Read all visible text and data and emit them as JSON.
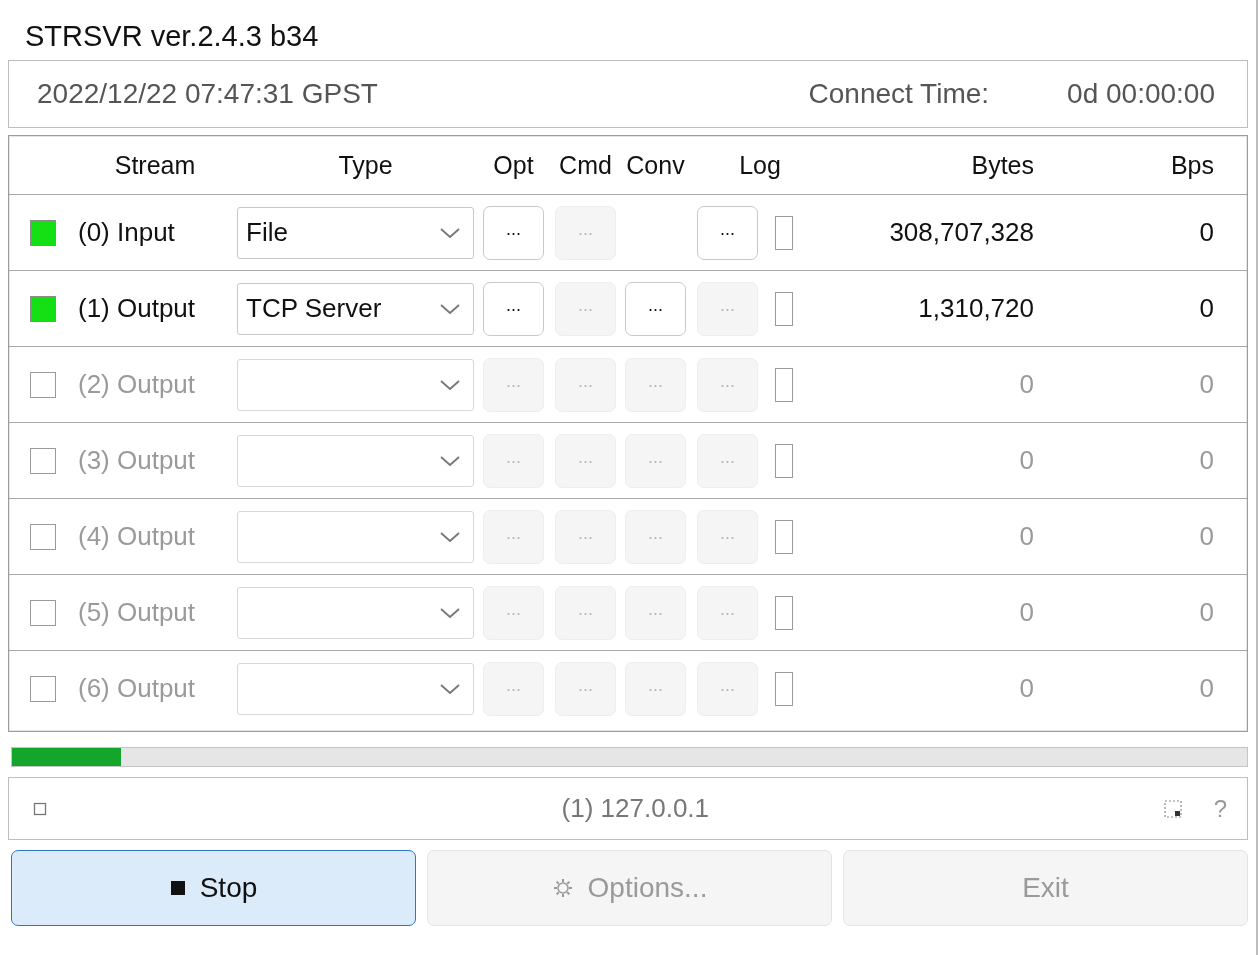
{
  "window": {
    "title": "STRSVR ver.2.4.3 b34"
  },
  "info": {
    "time": "2022/12/22 07:47:31 GPST",
    "connect_label": "Connect Time:",
    "connect_value": "0d 00:00:00"
  },
  "table": {
    "columns": [
      "Stream",
      "Type",
      "Opt",
      "Cmd",
      "Conv",
      "Log",
      "Bytes",
      "Bps"
    ],
    "rows": [
      {
        "on": true,
        "enabled": true,
        "label": "(0) Input",
        "type": "File",
        "buttons": [
          {
            "label": "...",
            "enabled": true,
            "shown": true
          },
          {
            "label": "...",
            "enabled": false,
            "shown": true
          },
          {
            "shown": false
          },
          {
            "label": "...",
            "enabled": true,
            "shown": true
          }
        ],
        "log_checked": false,
        "bytes": "308,707,328",
        "bps": "0"
      },
      {
        "on": true,
        "enabled": true,
        "label": "(1) Output",
        "type": "TCP Server",
        "buttons": [
          {
            "label": "...",
            "enabled": true,
            "shown": true
          },
          {
            "label": "...",
            "enabled": false,
            "shown": true
          },
          {
            "label": "...",
            "enabled": true,
            "shown": true
          },
          {
            "label": "...",
            "enabled": false,
            "shown": true
          }
        ],
        "log_checked": false,
        "bytes": "1,310,720",
        "bps": "0"
      },
      {
        "on": false,
        "enabled": false,
        "label": "(2) Output",
        "buttons": [
          {
            "label": "...",
            "enabled": false,
            "shown": true
          },
          {
            "label": "...",
            "enabled": false,
            "shown": true
          },
          {
            "label": "...",
            "enabled": false,
            "shown": true
          },
          {
            "label": "...",
            "enabled": false,
            "shown": true
          }
        ],
        "log_checked": false,
        "bytes": "0",
        "bps": "0"
      },
      {
        "on": false,
        "enabled": false,
        "label": "(3) Output",
        "buttons": [
          {
            "label": "...",
            "enabled": false,
            "shown": true
          },
          {
            "label": "...",
            "enabled": false,
            "shown": true
          },
          {
            "label": "...",
            "enabled": false,
            "shown": true
          },
          {
            "label": "...",
            "enabled": false,
            "shown": true
          }
        ],
        "log_checked": false,
        "bytes": "0",
        "bps": "0"
      },
      {
        "on": false,
        "enabled": false,
        "label": "(4) Output",
        "buttons": [
          {
            "label": "...",
            "enabled": false,
            "shown": true
          },
          {
            "label": "...",
            "enabled": false,
            "shown": true
          },
          {
            "label": "...",
            "enabled": false,
            "shown": true
          },
          {
            "label": "...",
            "enabled": false,
            "shown": true
          }
        ],
        "log_checked": false,
        "bytes": "0",
        "bps": "0"
      },
      {
        "on": false,
        "enabled": false,
        "label": "(5) Output",
        "buttons": [
          {
            "label": "...",
            "enabled": false,
            "shown": true
          },
          {
            "label": "...",
            "enabled": false,
            "shown": true
          },
          {
            "label": "...",
            "enabled": false,
            "shown": true
          },
          {
            "label": "...",
            "enabled": false,
            "shown": true
          }
        ],
        "log_checked": false,
        "bytes": "0",
        "bps": "0"
      },
      {
        "on": false,
        "enabled": false,
        "label": "(6) Output",
        "buttons": [
          {
            "label": "...",
            "enabled": false,
            "shown": true
          },
          {
            "label": "...",
            "enabled": false,
            "shown": true
          },
          {
            "label": "...",
            "enabled": false,
            "shown": true
          },
          {
            "label": "...",
            "enabled": false,
            "shown": true
          }
        ],
        "log_checked": false,
        "bytes": "0",
        "bps": "0"
      }
    ]
  },
  "progress": {
    "level": 0.088
  },
  "status_bar": {
    "text": "(1) 127.0.0.1",
    "help": "?"
  },
  "buttons": [
    {
      "kind": "stop",
      "label": "Stop",
      "enabled": true,
      "focused": true
    },
    {
      "kind": "options",
      "label": "Options...",
      "enabled": false,
      "focused": false
    },
    {
      "kind": "exit",
      "label": "Exit",
      "enabled": false,
      "focused": false
    }
  ]
}
